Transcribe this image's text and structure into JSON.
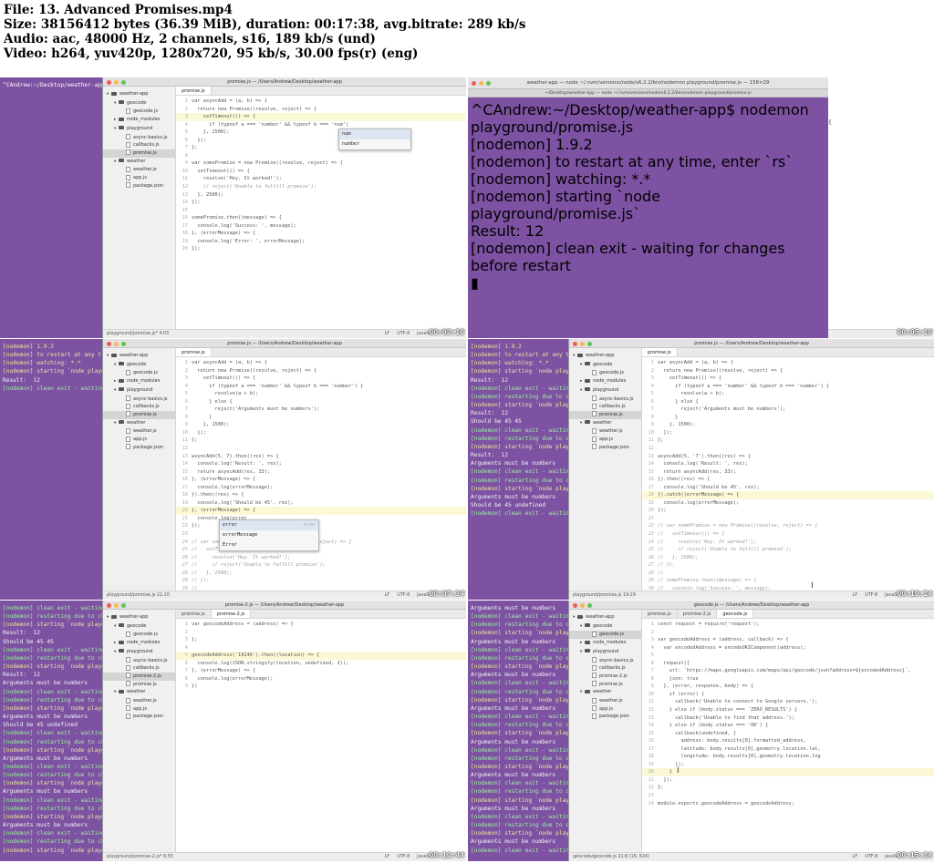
{
  "info": {
    "file": "File: 13. Advanced Promises.mp4",
    "size": "Size: 38156412 bytes (36.39 MiB), duration: 00:17:38, avg.bitrate: 289 kb/s",
    "audio": "Audio: aac, 48000 Hz, 2 channels, s16, 189 kb/s (und)",
    "video": "Video: h264, yuv420p, 1280x720, 95 kb/s, 30.00 fps(r) (eng)"
  },
  "thumbs": [
    {
      "timestamp": "00:02:10",
      "window_title": "promise.js — /Users/Andrew/Desktop/weather-app",
      "tabs": [
        "promise.js"
      ],
      "status_left": "playground/promise.js*   4:03",
      "status_right": [
        "LF",
        "UTF-8",
        "JavaSc"
      ],
      "tree": [
        "weather-app",
        "geocode",
        "geocode.js",
        "node_modules",
        "playground",
        "async-basics.js",
        "callbacks.js",
        "promise.js",
        "weather",
        "weather.js",
        "app.js",
        "package.json"
      ],
      "term_lines": [
        "^CAndrew:~/Desktop/weather-app$"
      ],
      "code": [
        "var asyncAdd = (a, b) => {",
        "  return new Promise((resolve, reject) => {",
        "    setTimeout(() => {",
        "      if (typeof a === 'number' && typeof b === 'num')",
        "    }, 1500);",
        "  });",
        "};",
        "",
        "var somePromise = new Promise((resolve, reject) => {",
        "  setTimeout(() => {",
        "    resolve('Hey. It worked!');",
        "    // reject('Unable to fulfill promise');",
        "  }, 2500);",
        "});",
        "",
        "somePromise.then((message) => {",
        "  console.log('Success: ', message);",
        "}, (errorMessage) => {",
        "  console.log('Error: ', errorMessage);",
        "});"
      ],
      "autocomplete": [
        "num",
        "number"
      ]
    },
    {
      "timestamp": "00:05:10",
      "window_title": "weather-app — node ~/.nvm/versions/node/v6.2.2/bin/nodemon playground/promise.js — 158×29",
      "tab_title": "~/Desktop/weather-app — node ~/.nvm/versions/node/v6.2.2/bin/nodemon playground/promise.js",
      "term_lines": [
        "^CAndrew:~/Desktop/weather-app$ nodemon playground/promise.js",
        "[nodemon] 1.9.2",
        "[nodemon] to restart at any time, enter `rs`",
        "[nodemon] watching: *.*",
        "[nodemon] starting `node playground/promise.js`",
        "Result:  12",
        "[nodemon] clean exit - waiting for changes before restart"
      ]
    },
    {
      "timestamp": "00:07:34",
      "window_title": "promise.js — /Users/Andrew/Desktop/weather-app",
      "tabs": [
        "promise.js"
      ],
      "status_left": "playground/promise.js   21:20",
      "status_right": [
        "LF",
        "UTF-8",
        "JavaSc"
      ],
      "tree": [
        "weather-app",
        "geocode",
        "geocode.js",
        "node_modules",
        "playground",
        "async-basics.js",
        "callbacks.js",
        "promise.js",
        "weather",
        "weather.js",
        "app.js",
        "package.json"
      ],
      "term_lines": [
        "[nodemon] 1.9.2",
        "[nodemon] to restart at any time",
        "[nodemon] watching: *.*",
        "[nodemon] starting `node playg",
        "Result:  12",
        "[nodemon] clean exit - waiting"
      ],
      "code": [
        "var asyncAdd = (a, b) => {",
        "  return new Promise((resolve, reject) => {",
        "    setTimeout(() => {",
        "      if (typeof a === 'number' && typeof b === 'number') {",
        "        resolve(a + b);",
        "      } else {",
        "        reject('Arguments must be numbers');",
        "      }",
        "    }, 1500);",
        "  });",
        "};",
        "",
        "asyncAdd(5, 7).then((res) => {",
        "  console.log('Result: ', res);",
        "  return asyncAdd(res, 33);",
        "}, (errorMessage) => {",
        "  console.log(errorMessage);",
        "}).then((res) => {",
        "  console.log('Should be 45', res);",
        "}, (errorMessage) => {",
        "  console.log(error",
        "});",
        "",
        "// var somePromise = new Promise((resolve, reject) => {",
        "//   setTimeout(() => {",
        "//     resolve('Hey. It worked!');",
        "//     // reject('Unable to fulfill promise');",
        "//   }, 2500);",
        "// });",
        "//"
      ],
      "autocomplete": [
        "error",
        "errorMessage",
        "Error"
      ],
      "ac_hint": "error"
    },
    {
      "timestamp": "00:10:14",
      "window_title": "promise.js — /Users/Andrew/Desktop/weather-app",
      "tabs": [
        "promise.js"
      ],
      "status_left": "playground/promise.js   19:29",
      "status_right": [
        "LF",
        "UTF-8",
        "JavaSc"
      ],
      "tree": [
        "weather-app",
        "geocode",
        "geocode.js",
        "node_modules",
        "playground",
        "async-basics.js",
        "callbacks.js",
        "promise.js",
        "weather",
        "weather.js",
        "app.js",
        "package.json"
      ],
      "term_lines": [
        "[nodemon] 1.9.2",
        "[nodemon] to restart at any ti",
        "[nodemon] watching: *.*",
        "[nodemon] starting `node playg",
        "Result:  12",
        "[nodemon] clean exit - waiting",
        "[nodemon] restarting due to ch",
        "[nodemon] starting `node playg",
        "Result:  12",
        "Should be 45 45",
        "[nodemon] clean exit - waiting",
        "[nodemon] restarting due to ch",
        "[nodemon] starting `node playg",
        "Result:  12",
        "Arguments must be numbers",
        "[nodemon] clean exit - waiting",
        "[nodemon] restarting due to ch",
        "[nodemon] starting `node playg",
        "Arguments must be numbers",
        "Should be 45 undefined",
        "[nodemon] clean exit - waiting"
      ],
      "code": [
        "var asyncAdd = (a, b) => {",
        "  return new Promise((resolve, reject) => {",
        "    setTimeout(() => {",
        "      if (typeof a === 'number' && typeof b === 'number') {",
        "        resolve(a + b);",
        "      } else {",
        "        reject('Arguments must be numbers');",
        "      }",
        "    }, 1500);",
        "  });",
        "};",
        "",
        "asyncAdd(5, '7').then((res) => {",
        "  console.log('Result: ', res);",
        "  return asyncAdd(res, 33);",
        "}).then((res) => {",
        "  console.log('Should be 45', res);",
        "}).catch((errorMessage) => {",
        "  console.log(errorMessage);",
        "});",
        "",
        "// var somePromise = new Promise((resolve, reject) => {",
        "//   setTimeout(() => {",
        "//     resolve('Hey. It worked!');",
        "//     // reject('Unable to fulfill promise');",
        "//   }, 2500);",
        "// });",
        "//",
        "// somePromise.then((message) => {",
        "//   console.log('Success: ', message);"
      ]
    },
    {
      "timestamp": "00:12:44",
      "window_title": "promise-2.js — /Users/Andrew/Desktop/weather-app",
      "tabs": [
        "promise.js",
        "promise-2.js"
      ],
      "status_left": "playground/promise-2.js*   6:55",
      "status_right": [
        "LF",
        "UTF-8",
        "JavaSc"
      ],
      "tree": [
        "weather-app",
        "geocode",
        "geocode.js",
        "node_modules",
        "playground",
        "async-basics.js",
        "callbacks.js",
        "promise-2.js",
        "promise.js",
        "weather",
        "weather.js",
        "app.js",
        "package.json"
      ],
      "term_lines": [
        "[nodemon] clean exit - waiting",
        "[nodemon] restarting due to ch",
        "[nodemon] starting `node playg",
        "Result:  12",
        "Should be 45 45",
        "[nodemon] clean exit - waiting",
        "[nodemon] restarting due to ch",
        "[nodemon] starting `node playg",
        "Result:  12",
        "Arguments must be numbers",
        "[nodemon] clean exit - waiting",
        "[nodemon] restarting due to ch",
        "[nodemon] starting `node playg",
        "Arguments must be numbers",
        "Should be 45 undefined",
        "[nodemon] clean exit - waiting",
        "[nodemon] restarting due to ch",
        "[nodemon] starting `node playg",
        "Arguments must be numbers",
        "[nodemon] clean exit - waiting",
        "[nodemon] restarting due to ch",
        "[nodemon] starting `node playg",
        "Arguments must be numbers",
        "[nodemon] clean exit - waiting",
        "[nodemon] restarting due to ch",
        "[nodemon] starting `node playg",
        "Arguments must be numbers",
        "[nodemon] clean exit - waiting",
        "[nodemon] restarting due to ch",
        "[nodemon] starting `node playg"
      ],
      "code": [
        "var geocodeAddress = (address) => {",
        "",
        "};",
        "",
        "geocodeAddress('19146').then((location) => {",
        "  console.log(JSON.stringify(location, undefined, 2));",
        "}, (errorMessage) => {",
        "  console.log(errorMessage);",
        "})"
      ]
    },
    {
      "timestamp": "00:15:14",
      "window_title": "geocode.js — /Users/Andrew/Desktop/weather-app",
      "tabs": [
        "promise.js",
        "promise-2.js",
        "geocode.js"
      ],
      "status_left": "geocode/geocode.js   21:6   (16, 624)",
      "status_right": [
        "LF",
        "UTF-8",
        "JavaSc"
      ],
      "tree": [
        "weather-app",
        "geocode",
        "geocode.js",
        "node_modules",
        "playground",
        "async-basics.js",
        "callbacks.js",
        "promise-2.js",
        "promise.js",
        "weather",
        "weather.js",
        "app.js",
        "package.json"
      ],
      "term_lines": [
        "Arguments must be numbers",
        "[nodemon] clean exit - waiting",
        "[nodemon] restarting due to ch",
        "[nodemon] starting `node playg",
        "Arguments must be numbers",
        "[nodemon] clean exit - waiting",
        "[nodemon] restarting due to ch",
        "[nodemon] starting `node playg",
        "Arguments must be numbers",
        "[nodemon] clean exit - waiting",
        "[nodemon] restarting due to ch",
        "[nodemon] starting `node playg",
        "Arguments must be numbers",
        "[nodemon] clean exit - waiting",
        "[nodemon] restarting due to ch",
        "[nodemon] starting `node playg",
        "Arguments must be numbers",
        "[nodemon] clean exit - waiting",
        "[nodemon] restarting due to ch",
        "[nodemon] starting `node playg",
        "Arguments must be numbers",
        "[nodemon] clean exit - waiting",
        "[nodemon] restarting due to ch",
        "[nodemon] starting `node playg",
        "Arguments must be numbers",
        "[nodemon] clean exit - waiting",
        "[nodemon] restarting due to ch",
        "[nodemon] starting `node playg",
        "Arguments must be numbers",
        "[nodemon] clean exit - waiting"
      ],
      "code": [
        "const request = require('request');",
        "",
        "var geocodeAddress = (address, callback) => {",
        "  var encodedAddress = encodeURIComponent(address);",
        "",
        "  request({",
        "    url: `https://maps.googleapis.com/maps/api/geocode/json?address=${encodedAddress}`,",
        "    json: true",
        "  }, (error, response, body) => {",
        "    if (error) {",
        "      callback('Unable to connect to Google servers.');",
        "    } else if (body.status === 'ZERO_RESULTS') {",
        "      callback('Unable to find that address.');",
        "    } else if (body.status === 'OK') {",
        "      callback(undefined, {",
        "        address: body.results[0].formatted_address,",
        "        latitude: body.results[0].geometry.location.lat,",
        "        longitude: body.results[0].geometry.location.lng",
        "      });",
        "    }",
        "  });",
        "};",
        "",
        "module.exports.geocodeAddress = geocodeAddress;"
      ]
    }
  ]
}
